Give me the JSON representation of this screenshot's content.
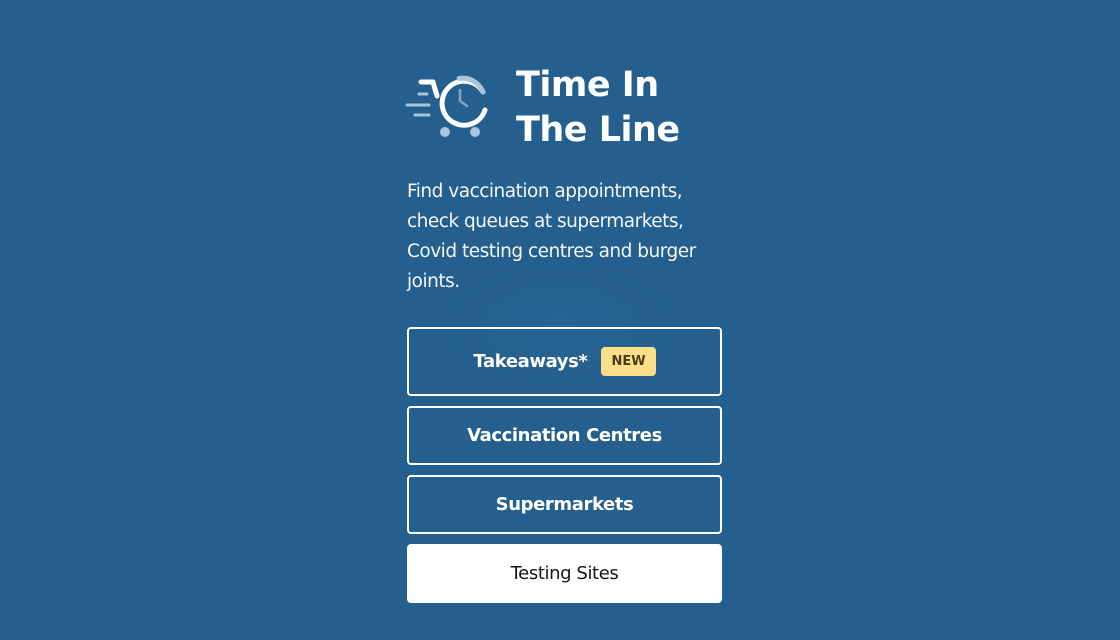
{
  "colors": {
    "background": "#245f8d",
    "badge": "#fbdf8a",
    "logo_accent": "#a9c4dc"
  },
  "header": {
    "logo_icon": "shopping-cart-clock-icon",
    "title_line1": "Time In",
    "title_line2": "The Line"
  },
  "description": "Find vaccination appointments, check queues at supermarkets, Covid testing centres and burger joints.",
  "nav": {
    "takeaways_label": "Takeaways*",
    "takeaways_badge": "NEW",
    "vaccination_label": "Vaccination Centres",
    "supermarkets_label": "Supermarkets",
    "testing_label": "Testing Sites"
  }
}
